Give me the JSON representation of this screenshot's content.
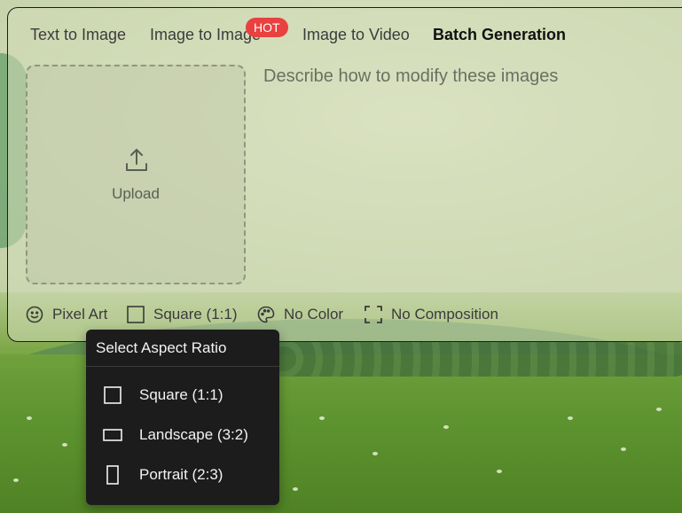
{
  "tabs": [
    {
      "label": "Text to Image"
    },
    {
      "label": "Image to Image",
      "badge": "HOT"
    },
    {
      "label": "Image to Video"
    },
    {
      "label": "Batch Generation",
      "active": true
    }
  ],
  "upload": {
    "label": "Upload",
    "icon": "upload-icon"
  },
  "prompt": {
    "placeholder": "Describe how to modify these images",
    "value": ""
  },
  "options": {
    "style": {
      "label": "Pixel Art",
      "icon": "smiley-icon"
    },
    "aspect": {
      "label": "Square (1:1)",
      "icon": "square-icon"
    },
    "color": {
      "label": "No Color",
      "icon": "palette-icon"
    },
    "composition": {
      "label": "No Composition",
      "icon": "frame-corners-icon"
    }
  },
  "aspect_menu": {
    "title": "Select Aspect Ratio",
    "items": [
      {
        "label": "Square (1:1)",
        "icon": "square-icon"
      },
      {
        "label": "Landscape (3:2)",
        "icon": "landscape-rect-icon"
      },
      {
        "label": "Portrait (2:3)",
        "icon": "portrait-rect-icon"
      }
    ]
  },
  "colors": {
    "hot_badge": "#e8413f",
    "menu_bg": "#1c1c1c"
  }
}
